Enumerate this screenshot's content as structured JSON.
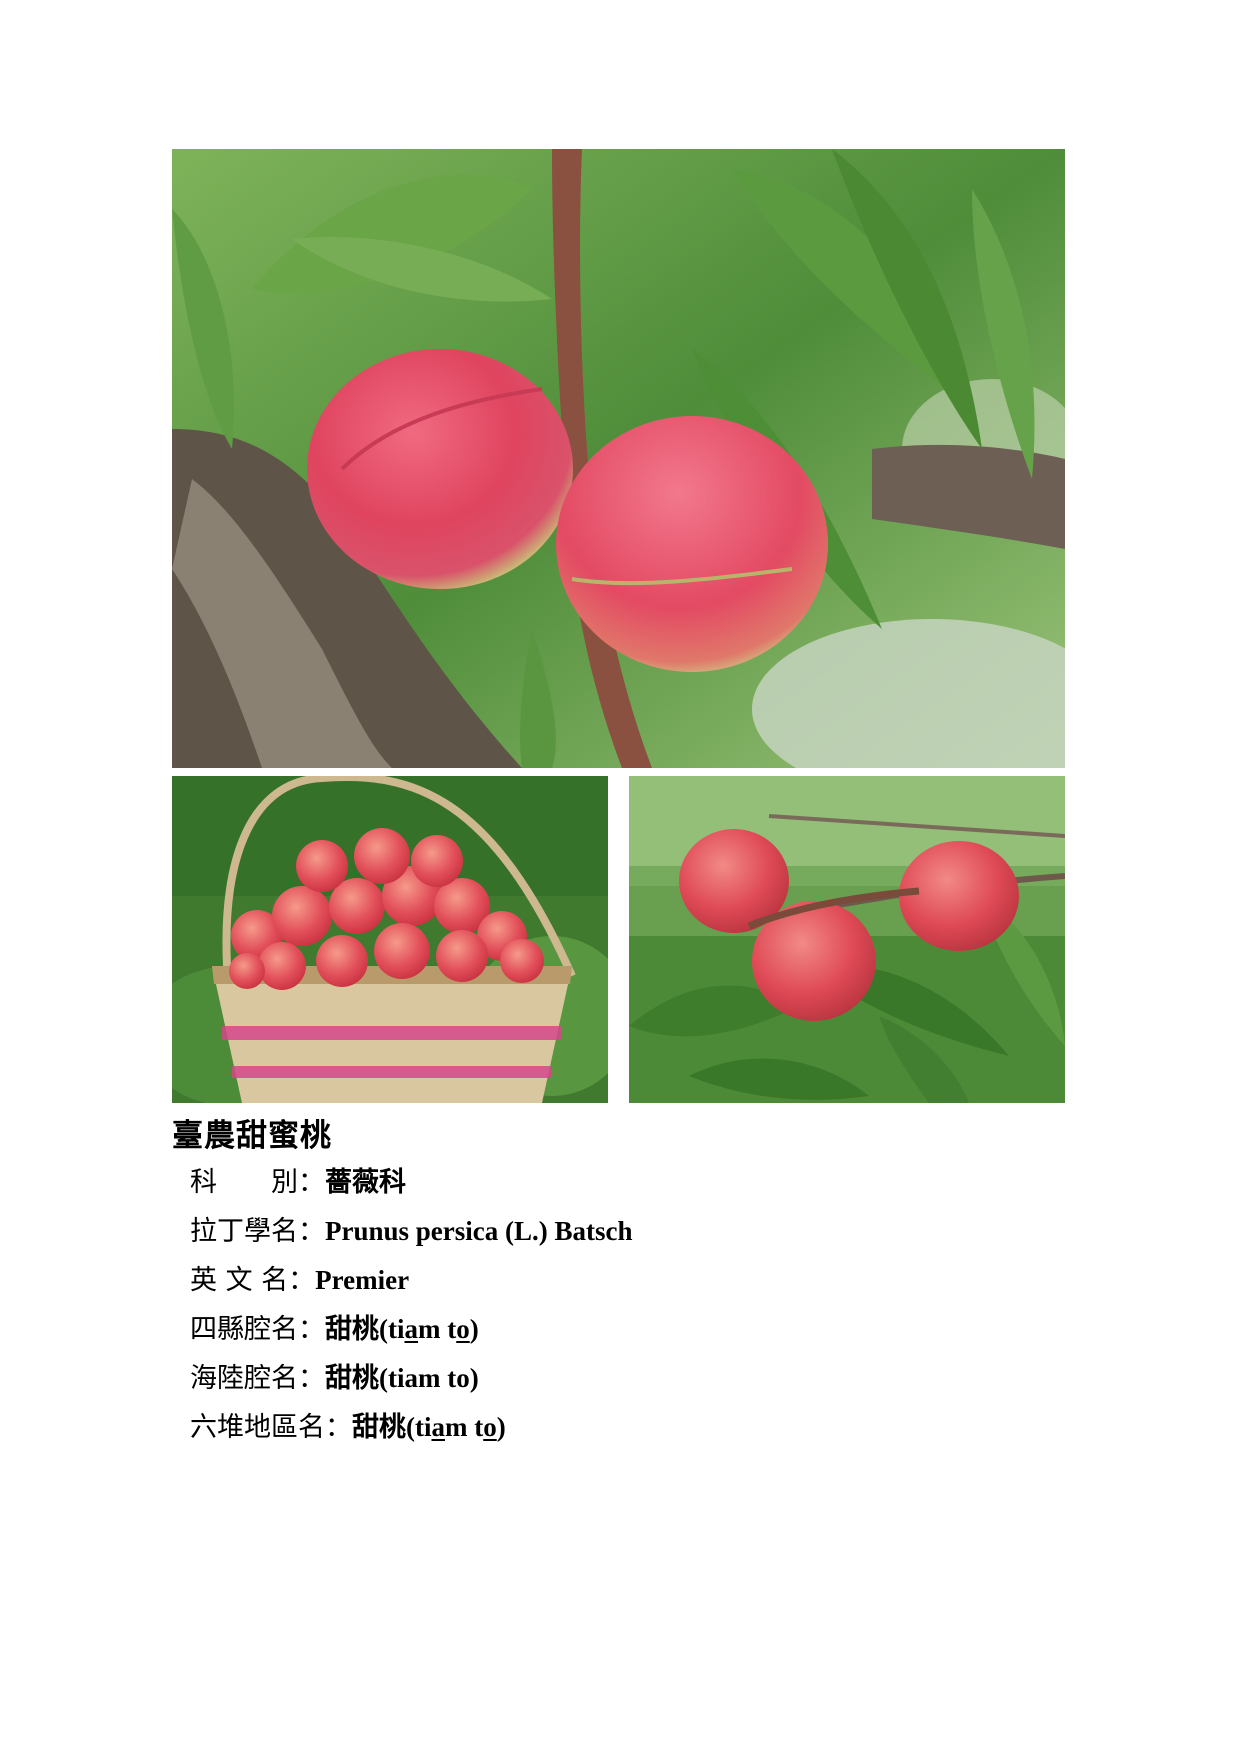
{
  "title": "臺農甜蜜桃",
  "fields": [
    {
      "label": "科　　別",
      "sep": "：",
      "parts": [
        {
          "text": "薔薇科",
          "cjk": true
        }
      ]
    },
    {
      "label": "拉丁學名",
      "sep": "：",
      "parts": [
        {
          "text": "Prunus persica (L.) Batsch"
        }
      ]
    },
    {
      "label": "英 文 名",
      "sep": "：",
      "parts": [
        {
          "text": "Premier"
        }
      ]
    },
    {
      "label": "四縣腔名",
      "sep": "：",
      "parts": [
        {
          "text": "甜桃",
          "cjk": true
        },
        {
          "text": "(ti"
        },
        {
          "text": "a",
          "underline": true
        },
        {
          "text": "m t"
        },
        {
          "text": "o",
          "underline": true
        },
        {
          "text": ")"
        }
      ]
    },
    {
      "label": "海陸腔名",
      "sep": "：",
      "parts": [
        {
          "text": "甜桃",
          "cjk": true
        },
        {
          "text": "(tiam to)"
        }
      ]
    },
    {
      "label": "六堆地區名",
      "sep": "：",
      "parts": [
        {
          "text": "甜桃",
          "cjk": true
        },
        {
          "text": "(ti"
        },
        {
          "text": "a",
          "underline": true
        },
        {
          "text": "m t"
        },
        {
          "text": "o",
          "underline": true
        },
        {
          "text": ")"
        }
      ]
    }
  ],
  "photos": [
    {
      "subject": "two-peaches-on-branch"
    },
    {
      "subject": "basket-of-peaches"
    },
    {
      "subject": "peaches-on-tree"
    }
  ]
}
